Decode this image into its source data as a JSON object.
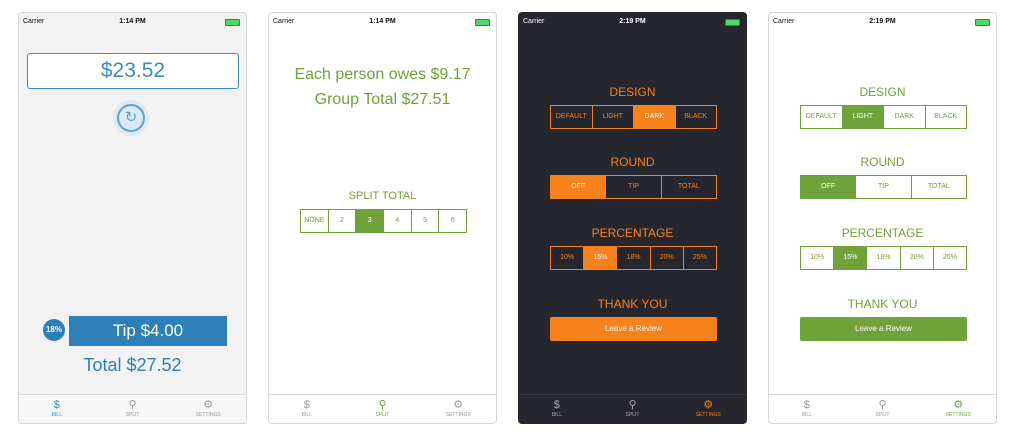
{
  "status": {
    "carrier": "Carrier",
    "time_a": "1:14 PM",
    "time_b": "2:19 PM"
  },
  "tabs": {
    "bill": "BILL",
    "split": "SPLIT",
    "settings": "SETTINGS"
  },
  "bill": {
    "amount": "$23.52",
    "tip_percent": "18%",
    "tip": "Tip $4.00",
    "total": "Total $27.52"
  },
  "split": {
    "owes": "Each person owes  $9.17",
    "group_total": "Group Total $27.51",
    "label": "SPLIT TOTAL",
    "options": [
      "NONE",
      "2",
      "3",
      "4",
      "5",
      "6"
    ],
    "selected": "3"
  },
  "settings": {
    "design_title": "DESIGN",
    "design_options": [
      "DEFAULT",
      "LIGHT",
      "DARK",
      "BLACK"
    ],
    "round_title": "ROUND",
    "round_options": [
      "OFF",
      "TIP",
      "TOTAL"
    ],
    "percentage_title": "PERCENTAGE",
    "percentage_options": [
      "10%",
      "15%",
      "18%",
      "20%",
      "25%"
    ],
    "thanks_title": "THANK YOU",
    "review_button": "Leave a Review"
  },
  "colors": {
    "blue": "#2d7fb8",
    "green": "#6fa23a",
    "orange": "#f7821b",
    "dark_bg": "#26272e"
  }
}
